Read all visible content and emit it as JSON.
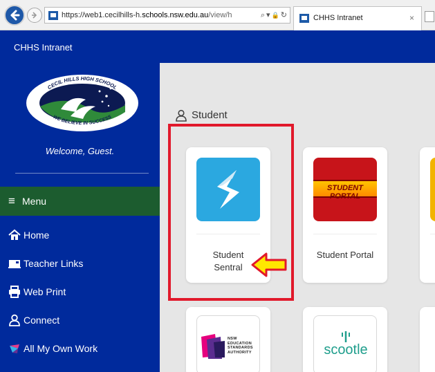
{
  "browser": {
    "url_scheme": "https://",
    "url_sub": "web1.cecilhills-h.",
    "url_host": "schools.nsw.edu.au",
    "url_path": "/view/h",
    "addr_search": "⌕",
    "addr_dropdown": "▾",
    "addr_lock": "🔒",
    "addr_refresh": "↻",
    "tab_title": "CHHS Intranet",
    "tab_close": "×"
  },
  "header": {
    "title": "CHHS Intranet"
  },
  "sidebar": {
    "logo": {
      "top_text": "CECIL HILLS HIGH SCHOOL",
      "bottom_text": "WE BELIEVE IN SUCCESS"
    },
    "welcome": "Welcome, Guest.",
    "menu_icon": "≡",
    "menu_label": "Menu",
    "items": [
      {
        "label": "Home",
        "icon": "home-icon"
      },
      {
        "label": "Teacher Links",
        "icon": "projector-icon"
      },
      {
        "label": "Web Print",
        "icon": "printer-icon"
      },
      {
        "label": "Connect",
        "icon": "user-icon"
      },
      {
        "label": "All My Own Work",
        "icon": "aim-logo-icon"
      }
    ]
  },
  "main": {
    "section_title": "Student",
    "cards": [
      {
        "label_line1": "Student",
        "label_line2": "Sentral",
        "icon": "sentral-logo-icon"
      },
      {
        "label": "Student Portal",
        "logo_text": "STUDENT PORTAL",
        "icon": "student-portal-logo-icon"
      }
    ],
    "small_cards": [
      {
        "logo_text": [
          "NSW",
          "EDUCATION",
          "STANDARDS",
          "AUTHORITY"
        ],
        "icon": "nesa-logo-icon"
      },
      {
        "logo_text": "scootle",
        "icon": "scootle-logo-icon"
      }
    ]
  },
  "colors": {
    "brand_blue": "#002a9c",
    "menu_green": "#1c5c2f",
    "highlight_red": "#e1192b",
    "arrow_yellow": "#ffe800"
  }
}
